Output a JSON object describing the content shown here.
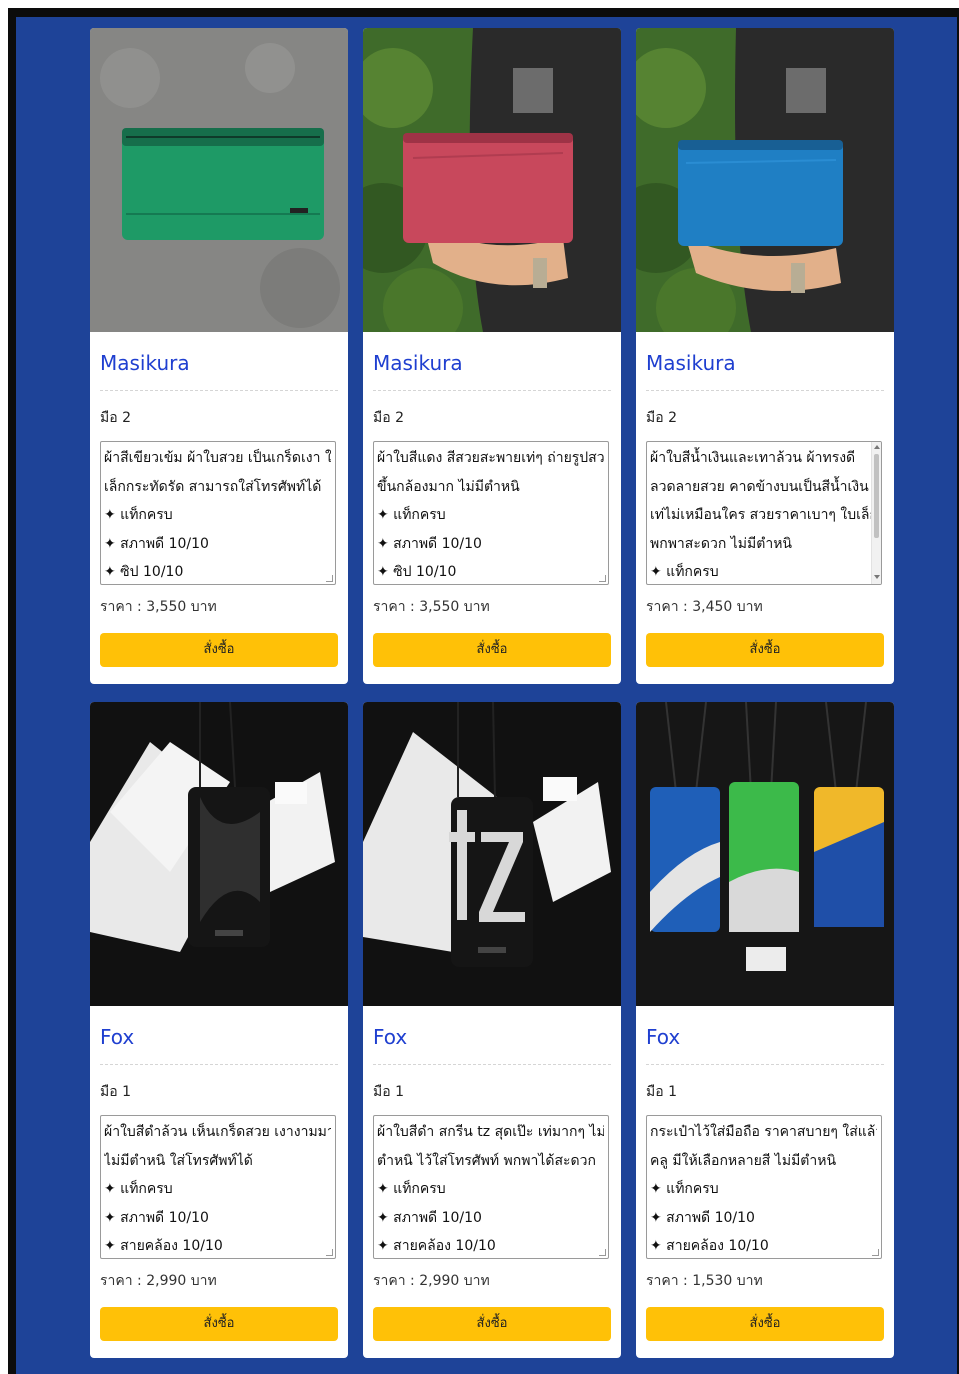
{
  "theme": {
    "background": "#1e4398",
    "accent": "#ffc107",
    "title_color": "#1f3fd0"
  },
  "products": [
    {
      "image_icon": "green-pouch-photo",
      "name": "Masikura",
      "condition": "มือ 2",
      "description_lines": [
        "ผ้าสีเขียวเข้ม ผ้าใบสวย เป็นเกร็ดเงา ใบ",
        "เล็กกระทัดรัด สามารถใส่โทรศัพท์ได้",
        "✦ แท็กครบ",
        "✦ สภาพดี  10/10",
        "✦ ซิป  10/10"
      ],
      "price": "ราคา : 3,550 บาท",
      "buy_label": "สั่งซื้อ"
    },
    {
      "image_icon": "red-pouch-photo",
      "name": "Masikura",
      "condition": "มือ 2",
      "description_lines": [
        "ผ้าใบสีแดง สีสวยสะพายเท่ๆ ถ่ายรูปสวย",
        "ขึ้นกล้องมาก ไม่มีตำหนิ",
        "✦ แท็กครบ",
        "✦ สภาพดี  10/10",
        "✦ ซิป  10/10"
      ],
      "price": "ราคา : 3,550 บาท",
      "buy_label": "สั่งซื้อ"
    },
    {
      "image_icon": "blue-pouch-photo",
      "name": "Masikura",
      "condition": "มือ 2",
      "description_lines": [
        "ผ้าใบสีน้ำเงินและเทาล้วน ผ้าทรงดี",
        "ลวดลายสวย คาดข้างบนเป็นสีน้ำเงิน",
        "เท่ไม่เหมือนใคร สวยราคาเบาๆ ใบเล็ก",
        "พกพาสะดวก ไม่มีตำหนิ",
        "✦ แท็กครบ"
      ],
      "price": "ราคา : 3,450 บาท",
      "buy_label": "สั่งซื้อ"
    },
    {
      "image_icon": "black-phone-pouch-photo",
      "name": "Fox",
      "condition": "มือ 1",
      "description_lines": [
        "ผ้าใบสีดำล้วน เห็นเกร็ดสวย เงางามมาก",
        "ไม่มีตำหนิ ใส่โทรศัพท์ได้",
        "✦ แท็กครบ",
        "✦ สภาพดี  10/10",
        "✦ สายคล้อง  10/10"
      ],
      "price": "ราคา : 2,990 บาท",
      "buy_label": "สั่งซื้อ"
    },
    {
      "image_icon": "tz-phone-pouch-photo",
      "name": "Fox",
      "condition": "มือ 1",
      "description_lines": [
        "ผ้าใบสีดำ สกรีน tz สุดเป๊ะ เท่มากๆ ไม่มี",
        "ตำหนิ ไว้ใส่โทรศัพท์ พกพาได้สะดวก",
        "✦ แท็กครบ",
        "✦ สภาพดี  10/10",
        "✦ สายคล้อง  10/10"
      ],
      "price": "ราคา : 2,990 บาท",
      "buy_label": "สั่งซื้อ"
    },
    {
      "image_icon": "three-phone-pouches-photo",
      "name": "Fox",
      "condition": "มือ 1",
      "description_lines": [
        "กระเป๋าไว้ใส่มือถือ ราคาสบายๆ ใส่แล้วดู",
        "คลู มีให้เลือกหลายสี ไม่มีตำหนิ",
        "✦ แท็กครบ",
        "✦ สภาพดี  10/10",
        "✦ สายคล้อง  10/10"
      ],
      "price": "ราคา : 1,530 บาท",
      "buy_label": "สั่งซื้อ"
    }
  ]
}
